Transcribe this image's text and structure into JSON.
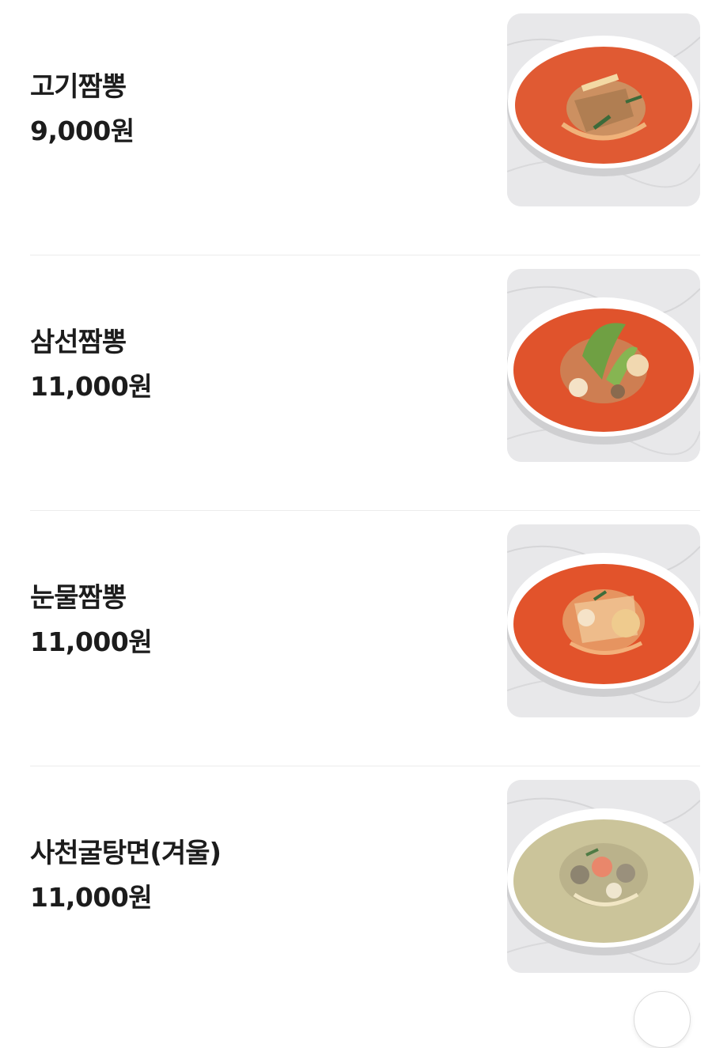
{
  "menu": {
    "items": [
      {
        "name": "고기짬뽕",
        "price": "9,000원",
        "soup_color": "#e25a32",
        "photo_icon": "meat-jjamppong-photo"
      },
      {
        "name": "삼선짬뽕",
        "price": "11,000원",
        "soup_color": "#e0532c",
        "photo_icon": "seafood-jjamppong-photo"
      },
      {
        "name": "눈물짬뽕",
        "price": "11,000원",
        "soup_color": "#e2532b",
        "photo_icon": "spicy-jjamppong-photo"
      },
      {
        "name": "사천굴탕면(겨울)",
        "price": "11,000원",
        "soup_color": "#cbc49a",
        "photo_icon": "oyster-noodle-soup-photo"
      }
    ]
  },
  "colors": {
    "text": "#1c1c1c",
    "divider": "#ececec",
    "marble": "#e9e9ea"
  }
}
